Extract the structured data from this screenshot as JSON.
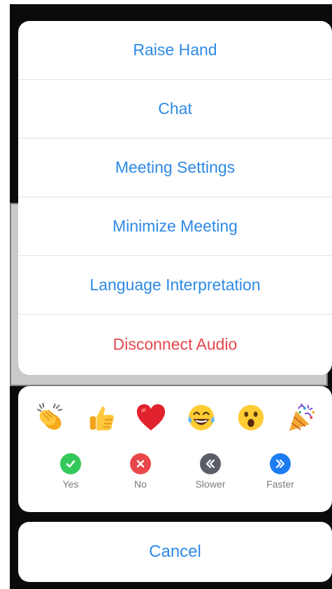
{
  "menu": {
    "items": [
      {
        "label": "Raise Hand"
      },
      {
        "label": "Chat"
      },
      {
        "label": "Meeting Settings"
      },
      {
        "label": "Minimize Meeting"
      },
      {
        "label": "Language Interpretation"
      },
      {
        "label": "Disconnect Audio"
      }
    ]
  },
  "reactions": {
    "emojis": [
      "clapping-hands-icon",
      "thumbs-up-icon",
      "red-heart-icon",
      "tears-of-joy-icon",
      "surprised-face-icon",
      "party-popper-icon"
    ],
    "statuses": [
      {
        "label": "Yes",
        "color": "#34c759"
      },
      {
        "label": "No",
        "color": "#e9474a"
      },
      {
        "label": "Slower",
        "color": "#5b5e66"
      },
      {
        "label": "Faster",
        "color": "#1e7cf2"
      }
    ]
  },
  "cancel": {
    "label": "Cancel"
  },
  "colors": {
    "accent": "#2e8ae6",
    "danger": "#e5484d"
  }
}
